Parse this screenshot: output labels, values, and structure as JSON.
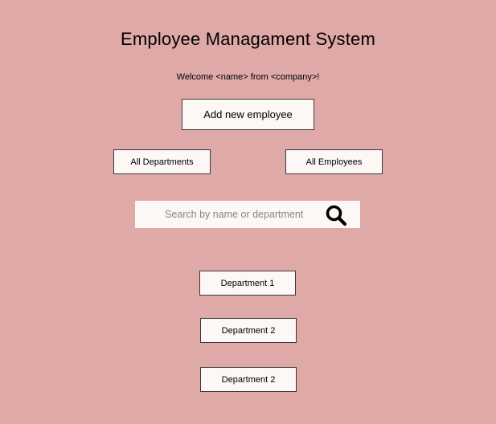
{
  "header": {
    "title": "Employee Managament System",
    "welcome": "Welcome <name> from <company>!"
  },
  "actions": {
    "add_employee_label": "Add new employee",
    "all_departments_label": "All Departments",
    "all_employees_label": "All Employees"
  },
  "search": {
    "placeholder": "Search by name or department",
    "value": "",
    "icon": "search-icon"
  },
  "departments": [
    {
      "label": "Department 1"
    },
    {
      "label": "Department 2"
    },
    {
      "label": "Department 2"
    }
  ],
  "colors": {
    "background": "#dea9a7",
    "button_fill": "#fdf7f6",
    "button_border": "#3a3a3a",
    "placeholder_text": "#8a8585"
  }
}
